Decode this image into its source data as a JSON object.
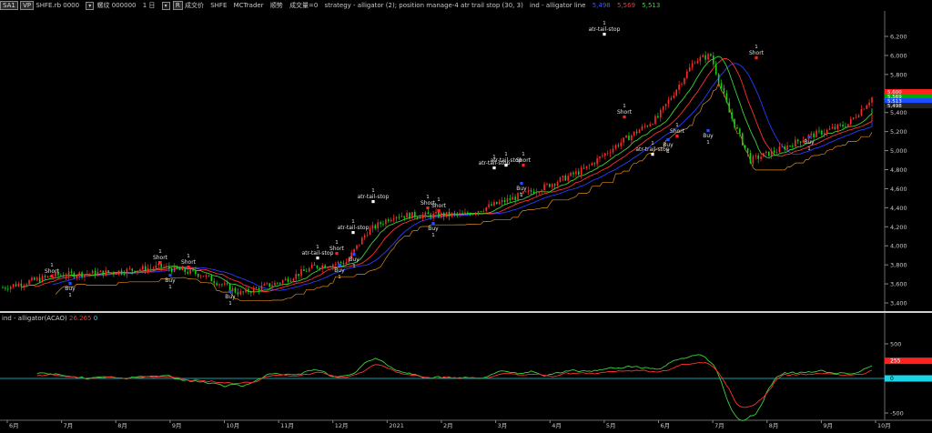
{
  "toolbar": {
    "symbol_box": "SA1",
    "vp_box": "VP",
    "exchange_symbol": "SHFE.rb 0000",
    "name_label": "螺纹 000000",
    "interval_label": "1 日",
    "rsmall_label": "R",
    "price_label": "成交价",
    "exchange": "SHFE",
    "platform": "MCTrader",
    "extra": "顺势",
    "volume_label": "成交量=0",
    "strategy": "strategy - alligator (2); position manage-4 atr trail stop (30, 3)",
    "indicator": "ind - alligator line",
    "value1": "5,498",
    "value2": "5,569",
    "value3": "5,513"
  },
  "price_axis": {
    "ticks": [
      "6,200",
      "6,000",
      "5,800",
      "5,600",
      "5,400",
      "5,200",
      "5,000",
      "4,800",
      "4,600",
      "4,400",
      "4,200",
      "4,000",
      "3,800",
      "3,600",
      "3,400"
    ],
    "labels_price": [
      {
        "text": "5,600",
        "color": "#ff2020"
      },
      {
        "text": "5,569",
        "color": "#00aa00"
      },
      {
        "text": "5,513",
        "color": "#1a4dff"
      },
      {
        "text": "5,498",
        "color": "#222222"
      }
    ]
  },
  "sub_panel": {
    "title": "ind - alligator(ACAO)",
    "value_red": "26.265",
    "value_cyan": "0",
    "ticks": [
      "500",
      "0",
      "-500"
    ],
    "badge_red": "255",
    "badge_cyan": "0"
  },
  "time_axis": [
    "6月",
    "7月",
    "8月",
    "9月",
    "10月",
    "11月",
    "12月",
    "2021",
    "2月",
    "3月",
    "4月",
    "5月",
    "6月",
    "7月",
    "8月",
    "9月",
    "10月"
  ],
  "signals": [
    {
      "kind": "short",
      "label": "Short",
      "count": "1"
    },
    {
      "kind": "buy",
      "label": "Buy",
      "count": "1"
    },
    {
      "kind": "short",
      "label": "Short",
      "count": "1"
    },
    {
      "kind": "buy",
      "label": "Buy",
      "count": "1"
    },
    {
      "kind": "short",
      "label": "Short",
      "count": "1"
    },
    {
      "kind": "buy",
      "label": "Buy",
      "count": "1"
    },
    {
      "kind": "stop",
      "label": "atr-tail-stop",
      "count": "1"
    },
    {
      "kind": "short",
      "label": "Short",
      "count": "1"
    },
    {
      "kind": "buy",
      "label": "Buy",
      "count": "1"
    },
    {
      "kind": "buy",
      "label": "Buy",
      "count": "1"
    },
    {
      "kind": "stop",
      "label": "atr-tail-stop",
      "count": "1"
    },
    {
      "kind": "stop",
      "label": "atr-tail-stop",
      "count": "1"
    },
    {
      "kind": "short",
      "label": "Short",
      "count": "1"
    },
    {
      "kind": "short",
      "label": "Short",
      "count": "1"
    },
    {
      "kind": "buy",
      "label": "Buy",
      "count": "1"
    },
    {
      "kind": "stop",
      "label": "atr-tail-stop",
      "count": "1"
    },
    {
      "kind": "short",
      "label": "Short",
      "count": "1"
    },
    {
      "kind": "buy",
      "label": "Buy",
      "count": "1"
    },
    {
      "kind": "stop",
      "label": "atr-tail-stop",
      "count": "1"
    },
    {
      "kind": "short",
      "label": "Short",
      "count": "1"
    },
    {
      "kind": "stop",
      "label": "atr-trail-stop",
      "count": "1"
    },
    {
      "kind": "buy",
      "label": "Buy",
      "count": "1"
    },
    {
      "kind": "short",
      "label": "Short",
      "count": "1"
    },
    {
      "kind": "buy",
      "label": "Buy",
      "count": "1"
    },
    {
      "kind": "stop",
      "label": "atr-tail-stop",
      "count": "1"
    },
    {
      "kind": "short",
      "label": "Short",
      "count": "1"
    },
    {
      "kind": "buy",
      "label": "Buy",
      "count": "1"
    }
  ],
  "colors": {
    "up": "#ff2a2a",
    "down": "#18d018",
    "jaw": "#2a3cff",
    "teeth": "#ff3030",
    "lips": "#3ad23a",
    "stop_line": "#e08a1a"
  }
}
